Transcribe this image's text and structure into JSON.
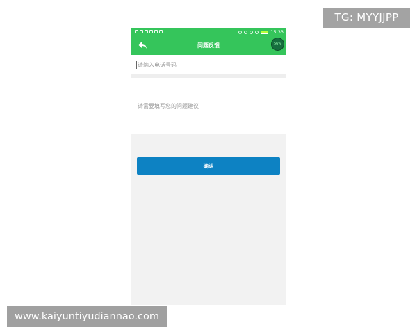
{
  "watermark": {
    "tg": "TG: MYYJJPP",
    "url": "www.kaiyuntiyudiannao.com"
  },
  "status_bar": {
    "time": "15:33",
    "icons_left": [
      "notification-icon",
      "image-icon",
      "shield-icon",
      "usb-icon",
      "wechat-icon",
      "app-icon"
    ],
    "icons_right": [
      "bluetooth-icon",
      "wifi-icon",
      "signal-icon",
      "alarm-icon",
      "battery-icon"
    ]
  },
  "nav": {
    "title": "问题反馈",
    "back_icon": "back-arrow-icon",
    "badge": "56%"
  },
  "form": {
    "phone_placeholder": "请输入电话号码",
    "suggestion_placeholder": "请需要填写您的问题建议",
    "confirm_label": "确认"
  },
  "colors": {
    "header": "#35c55b",
    "button": "#0d82c3",
    "background": "#f2f2f2"
  }
}
